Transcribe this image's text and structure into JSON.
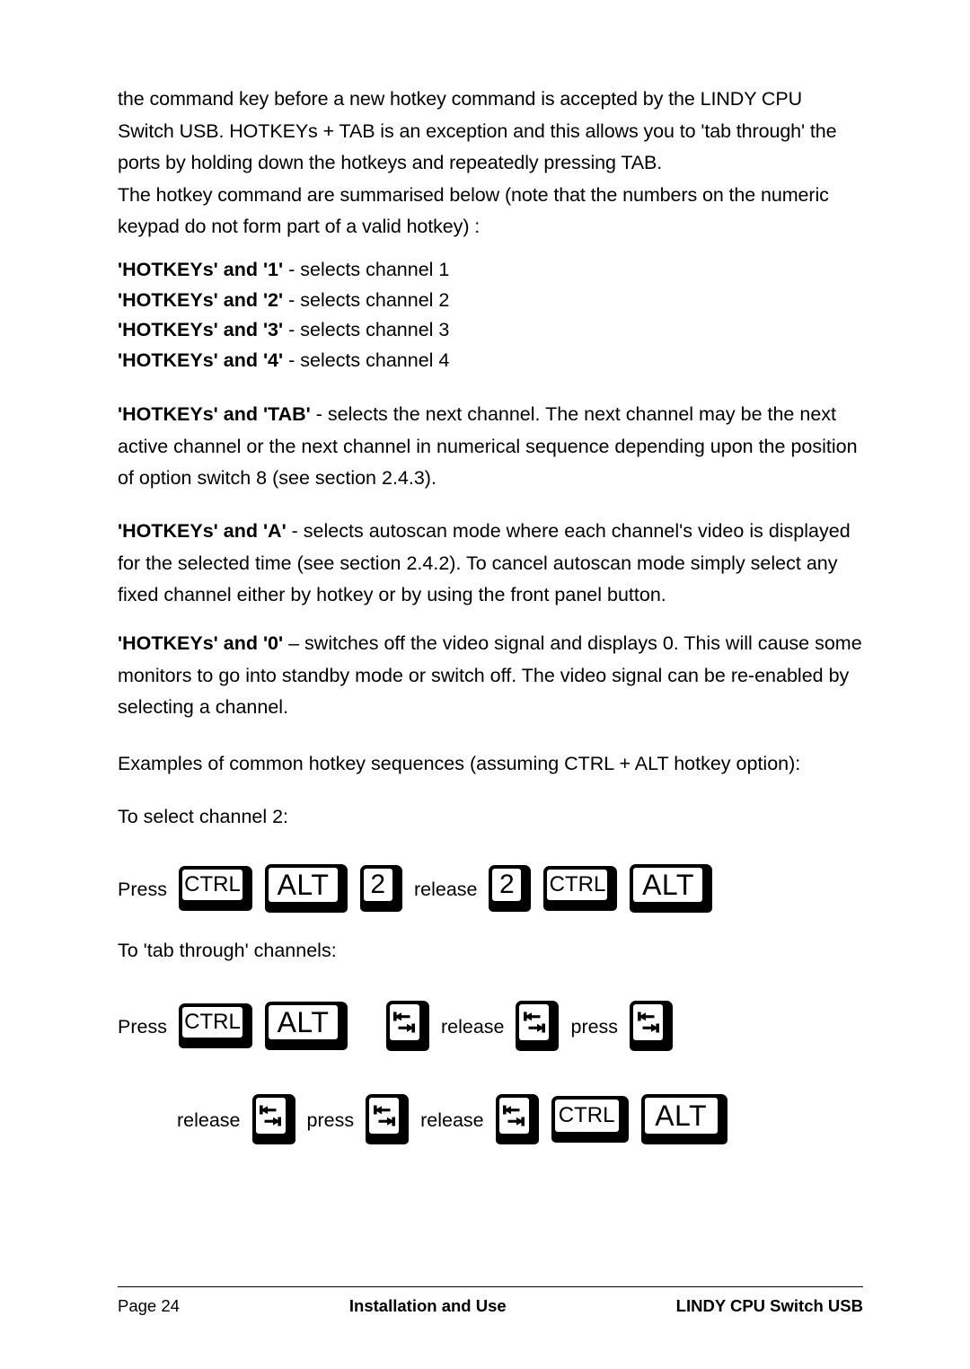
{
  "document": {
    "title": "LINDY CPU Switch USB",
    "page_label": "Page 24"
  },
  "intro": {
    "paragraph": "the command key before a new hotkey command is accepted by the LINDY CPU Switch USB. HOTKEYs + TAB is an exception and this allows you to 'tab through' the ports by holding down the hotkeys and repeatedly pressing TAB.",
    "paragraph2": "The hotkey command are summarised below (note that the numbers on the numeric keypad do not form part of a valid hotkey) :"
  },
  "hotkey_list": [
    {
      "key": "'HOTKEYs' and '1'",
      "desc": " - selects channel 1"
    },
    {
      "key": "'HOTKEYs' and '2'",
      "desc": " - selects channel 2"
    },
    {
      "key": "'HOTKEYs' and '3'",
      "desc": " - selects channel 3"
    },
    {
      "key": "'HOTKEYs' and '4'",
      "desc": " - selects channel 4"
    }
  ],
  "paragraphs": {
    "tab": {
      "lead": "'HOTKEYs' and 'TAB'",
      "text": " - selects the next channel. The next channel may be the next active channel or the next channel in numerical sequence depending upon the position of option switch 8 (see section 2.4.3)."
    },
    "autoscan": {
      "lead": "'HOTKEYs' and 'A'",
      "text": " - selects autoscan mode where each channel's video is displayed for the selected time (see section 2.4.2). To cancel autoscan mode simply select any fixed channel either by hotkey or by using the front panel button."
    },
    "zero": {
      "lead": "'HOTKEYs' and '0'",
      "text": " – switches off the video signal and displays 0. This will cause some monitors to go into standby mode or switch off. The video signal can be re-enabled by selecting a channel."
    },
    "examples": "Examples of common hotkey sequences (assuming CTRL + ALT hotkey option):",
    "select_channel": "To select channel 2:",
    "tab_through": "To 'tab through' channels:"
  },
  "sequences": {
    "select_channel_2": {
      "words": {
        "press": "Press",
        "release": "release"
      },
      "keys": {
        "ctrl": "CTRL",
        "alt": "ALT",
        "two": "2"
      }
    },
    "tab_through_row1": {
      "words": {
        "press": "Press",
        "release": "release",
        "press2": "press"
      },
      "keys": {
        "ctrl": "CTRL",
        "alt": "ALT",
        "tab": "tab-key"
      }
    },
    "tab_through_row2": {
      "words": {
        "release": "release",
        "press": "press",
        "release2": "release"
      },
      "keys": {
        "ctrl": "CTRL",
        "alt": "ALT",
        "tab": "tab-key"
      }
    }
  },
  "footer": {
    "left": "Page 24",
    "center": "Installation and Use",
    "right": "LINDY CPU Switch USB"
  }
}
